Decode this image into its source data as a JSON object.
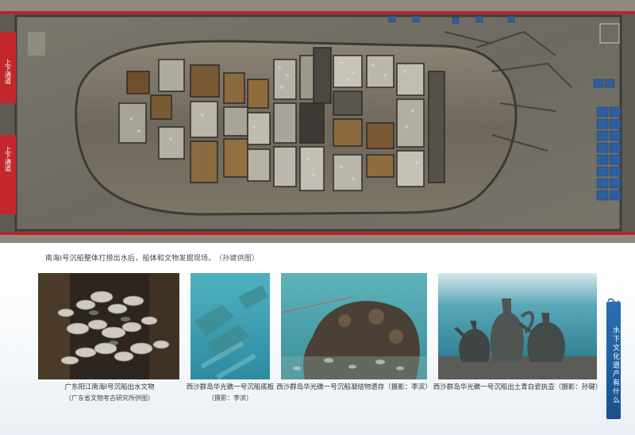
{
  "main_photo": {
    "caption": "南海Ⅰ号沉船整体打捞出水后，船体和文物发掘现场。",
    "credit": "（孙键供图）",
    "signs": [
      "上下通道",
      "上下通道"
    ]
  },
  "photos": [
    {
      "caption": "广东阳江南海Ⅰ号沉船出水文物",
      "credit": "（广东省文物考古研究所供图）"
    },
    {
      "caption": "西沙群岛华光礁一号沉船底板",
      "credit": "（摄影：李滨）"
    },
    {
      "caption": "西沙群岛华光礁一号沉船凝结物遗存（摄影：李滨）",
      "credit": ""
    },
    {
      "caption": "西沙群岛华光礁一号沉船出土青白瓷执壶（摄影：孙键）",
      "credit": ""
    }
  ],
  "side_tab": {
    "label": "水下文化遗产有什么"
  },
  "colors": {
    "accent": "#1f5fa3",
    "rail": "#c2242b"
  }
}
